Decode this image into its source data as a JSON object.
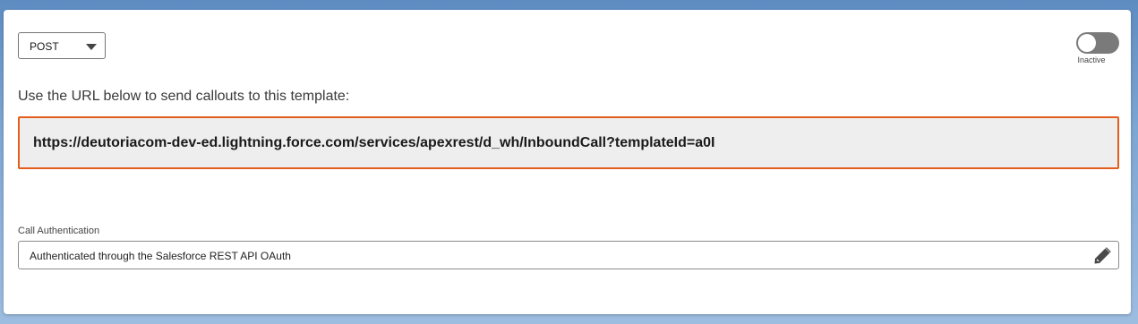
{
  "method_select": {
    "value": "POST",
    "caret_icon": "chevron-down-icon"
  },
  "status_toggle": {
    "state": "off",
    "label": "Inactive"
  },
  "url_section": {
    "instruction": "Use the URL below to send callouts to this template:",
    "url": "https://deutoriacom-dev-ed.lightning.force.com/services/apexrest/d_wh/InboundCall?templateId=a0I"
  },
  "call_authentication": {
    "label": "Call Authentication",
    "value": "Authenticated through the Salesforce REST API OAuth",
    "edit_icon": "pencil-icon"
  },
  "colors": {
    "url_border": "#e35d1c",
    "url_background": "#eeeeee",
    "toggle_off": "#7a7a7a"
  }
}
